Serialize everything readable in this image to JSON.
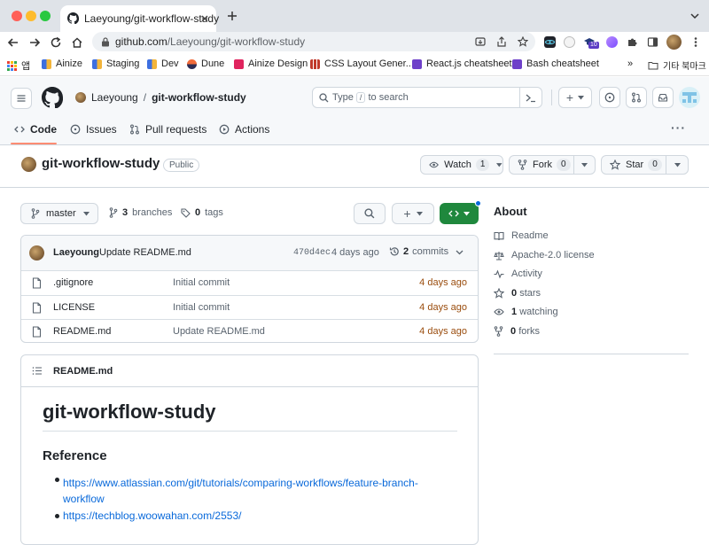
{
  "browser": {
    "tab_title": "Laeyoung/git-workflow-study",
    "url_host": "github.com",
    "url_path": "/Laeyoung/git-workflow-study",
    "bookmarks": [
      "앱",
      "Ainize",
      "Staging",
      "Dev",
      "Dune",
      "Ainize Design",
      "CSS Layout Gener...",
      "React.js cheatsheet",
      "Bash cheatsheet"
    ],
    "bookmarks_overflow": "»",
    "bookmarks_folder": "기타 북마크",
    "extension_badge": "10"
  },
  "header": {
    "owner": "Laeyoung",
    "separator": "/",
    "repo": "git-workflow-study",
    "search_placeholder_pre": "Type",
    "search_key": "/",
    "search_placeholder_post": "to search",
    "plus": "+"
  },
  "nav": {
    "tabs": [
      {
        "label": "Code",
        "active": true
      },
      {
        "label": "Issues"
      },
      {
        "label": "Pull requests"
      },
      {
        "label": "Actions"
      }
    ],
    "more": "···"
  },
  "repo": {
    "name": "git-workflow-study",
    "visibility": "Public",
    "watch_label": "Watch",
    "watch_count": "1",
    "fork_label": "Fork",
    "fork_count": "0",
    "star_label": "Star",
    "star_count": "0"
  },
  "filebar": {
    "branch": "master",
    "branches_count": "3",
    "branches_label": "branches",
    "tags_count": "0",
    "tags_label": "tags",
    "add": "+"
  },
  "commit": {
    "author": "Laeyoung",
    "message": "Update README.md",
    "sha": "470d4ec",
    "time": "4 days ago",
    "commits_count": "2",
    "commits_label": "commits"
  },
  "files": [
    {
      "name": ".gitignore",
      "message": "Initial commit",
      "time": "4 days ago"
    },
    {
      "name": "LICENSE",
      "message": "Initial commit",
      "time": "4 days ago"
    },
    {
      "name": "README.md",
      "message": "Update README.md",
      "time": "4 days ago"
    }
  ],
  "readme": {
    "file": "README.md",
    "h1": "git-workflow-study",
    "h2": "Reference",
    "links": [
      "https://www.atlassian.com/git/tutorials/comparing-workflows/feature-branch-workflow",
      "https://techblog.woowahan.com/2553/"
    ],
    "link1_line1": "https://www.atlassian.com/git/tutorials/comparing-workflows/feature-branch-",
    "link1_line2": "workflow"
  },
  "about": {
    "title": "About",
    "readme": "Readme",
    "license": "Apache-2.0 license",
    "activity": "Activity",
    "stars_count": "0",
    "stars_label": "stars",
    "watching_count": "1",
    "watching_label": "watching",
    "forks_count": "0",
    "forks_label": "forks"
  },
  "colors": {
    "accent": "#0969da",
    "code_button": "#1f883d",
    "time_orange": "#9a4d0e",
    "tab_underline": "#fd8c73"
  }
}
